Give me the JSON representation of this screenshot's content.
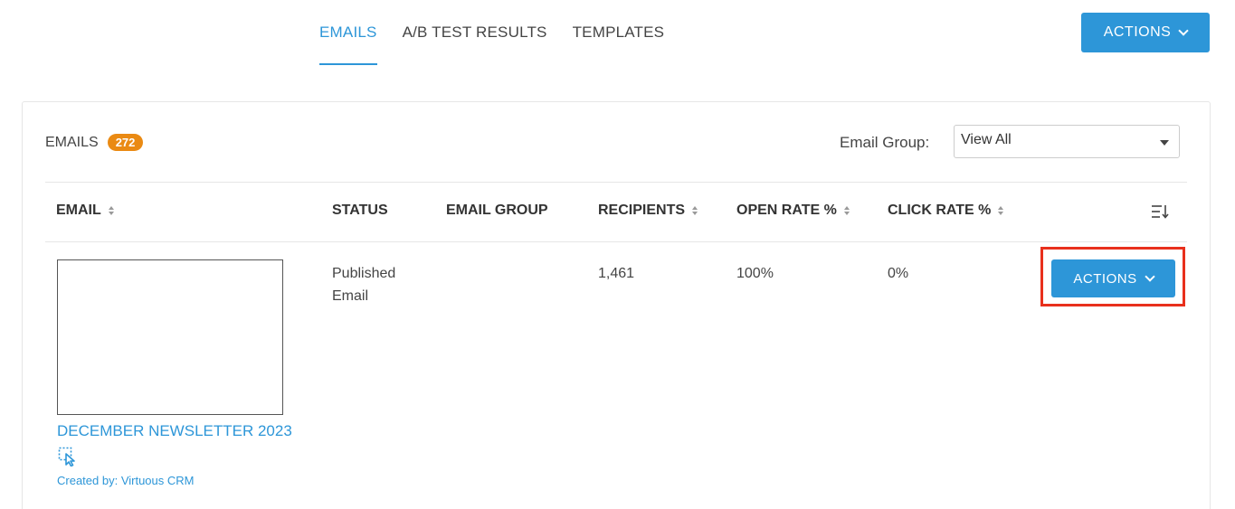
{
  "tabs": [
    {
      "label": "EMAILS",
      "active": true
    },
    {
      "label": "A/B TEST RESULTS",
      "active": false
    },
    {
      "label": "TEMPLATES",
      "active": false
    }
  ],
  "header": {
    "actions_label": "ACTIONS"
  },
  "emails_section": {
    "title": "EMAILS",
    "count": "272",
    "filter_label": "Email Group:",
    "filter_value": "View All"
  },
  "table": {
    "columns": [
      "EMAIL",
      "STATUS",
      "EMAIL GROUP",
      "RECIPIENTS",
      "OPEN RATE %",
      "CLICK RATE %"
    ],
    "rows": [
      {
        "email_name": "DECEMBER NEWSLETTER 2023",
        "created_by": "Created by: Virtuous CRM",
        "status_line1": "Published",
        "status_line2": "Email",
        "email_group": "",
        "recipients": "1,461",
        "open_rate": "100%",
        "click_rate": "0%",
        "actions_label": "ACTIONS"
      }
    ]
  },
  "colors": {
    "accent": "#2d96d8",
    "badge": "#ea8a13",
    "highlight": "#e8301c"
  },
  "icons": [
    "chevron-down-icon",
    "sort-icon",
    "column-settings-icon",
    "select-cursor-icon",
    "dropdown-caret-icon"
  ]
}
